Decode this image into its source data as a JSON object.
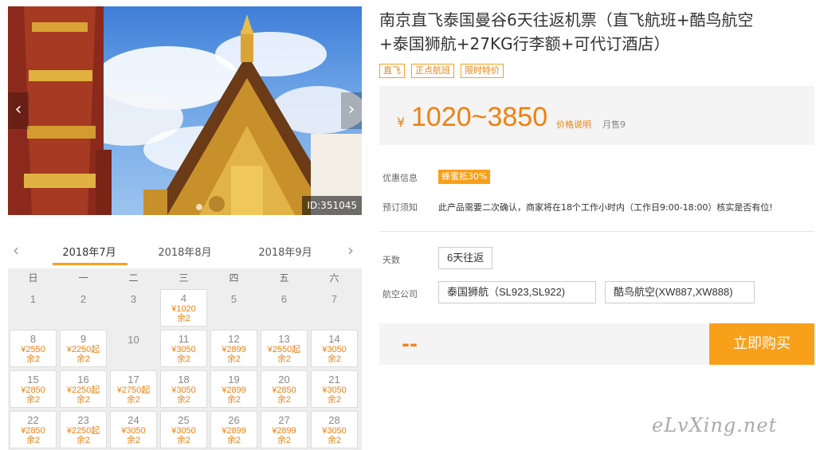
{
  "hero": {
    "id_label": "ID:351045",
    "prev_glyph": "‹",
    "next_glyph": "›"
  },
  "calendar": {
    "prev_glyph": "‹",
    "next_glyph": "›",
    "months": [
      "2018年7月",
      "2018年8月",
      "2018年9月"
    ],
    "active_month_index": 0,
    "weekdays": [
      "日",
      "一",
      "二",
      "三",
      "四",
      "五",
      "六"
    ],
    "days": [
      {
        "day": "1",
        "price": "",
        "remain": ""
      },
      {
        "day": "2",
        "price": "",
        "remain": ""
      },
      {
        "day": "3",
        "price": "",
        "remain": ""
      },
      {
        "day": "4",
        "price": "¥1020",
        "remain": "余2"
      },
      {
        "day": "5",
        "price": "",
        "remain": ""
      },
      {
        "day": "6",
        "price": "",
        "remain": ""
      },
      {
        "day": "7",
        "price": "",
        "remain": ""
      },
      {
        "day": "8",
        "price": "¥2550",
        "remain": "余2"
      },
      {
        "day": "9",
        "price": "¥2250起",
        "remain": "余2"
      },
      {
        "day": "10",
        "price": "",
        "remain": ""
      },
      {
        "day": "11",
        "price": "¥3050",
        "remain": "余2"
      },
      {
        "day": "12",
        "price": "¥2899",
        "remain": "余2"
      },
      {
        "day": "13",
        "price": "¥2550起",
        "remain": "余2"
      },
      {
        "day": "14",
        "price": "¥3050",
        "remain": "余2"
      },
      {
        "day": "15",
        "price": "¥2850",
        "remain": "余2"
      },
      {
        "day": "16",
        "price": "¥2250起",
        "remain": "余2"
      },
      {
        "day": "17",
        "price": "¥2750起",
        "remain": "余2"
      },
      {
        "day": "18",
        "price": "¥3050",
        "remain": "余2"
      },
      {
        "day": "19",
        "price": "¥2899",
        "remain": "余2"
      },
      {
        "day": "20",
        "price": "¥2850",
        "remain": "余2"
      },
      {
        "day": "21",
        "price": "¥3050",
        "remain": "余2"
      },
      {
        "day": "22",
        "price": "¥2850",
        "remain": "余2"
      },
      {
        "day": "23",
        "price": "¥2250起",
        "remain": "余2"
      },
      {
        "day": "24",
        "price": "¥3050",
        "remain": "余2"
      },
      {
        "day": "25",
        "price": "¥3050",
        "remain": "余2"
      },
      {
        "day": "26",
        "price": "¥2899",
        "remain": "余2"
      },
      {
        "day": "27",
        "price": "¥2899",
        "remain": "余2"
      },
      {
        "day": "28",
        "price": "¥3050",
        "remain": "余2"
      }
    ]
  },
  "product": {
    "title_line1": "南京直飞泰国曼谷6天往返机票（直飞航班+酷鸟航空",
    "title_line2": "+泰国狮航+27KG行李额+可代订酒店）",
    "tags": [
      "直飞",
      "正点航班",
      "限时特价"
    ],
    "price_symbol": "¥",
    "price_range": "1020~3850",
    "price_explain": "价格说明",
    "monthly_sales": "月售9",
    "promo_label": "优惠信息",
    "promo_badge": "蜂蜜抵30%",
    "notice_label": "预订须知",
    "notice_text": "此产品需要二次确认，商家将在18个工作小时内（工作日9:00-18:00）核实是否有位!",
    "days_label": "天数",
    "days_option": "6天往返",
    "airline_label": "航空公司",
    "airline_options": [
      "泰国狮航（SL923,SL922)",
      "酷鸟航空(XW887,XW888)"
    ],
    "total_placeholder": "--",
    "buy_label": "立即购买"
  },
  "watermark": "eLvXing.net",
  "colors": {
    "accent": "#f9a01b",
    "price": "#f08010"
  }
}
